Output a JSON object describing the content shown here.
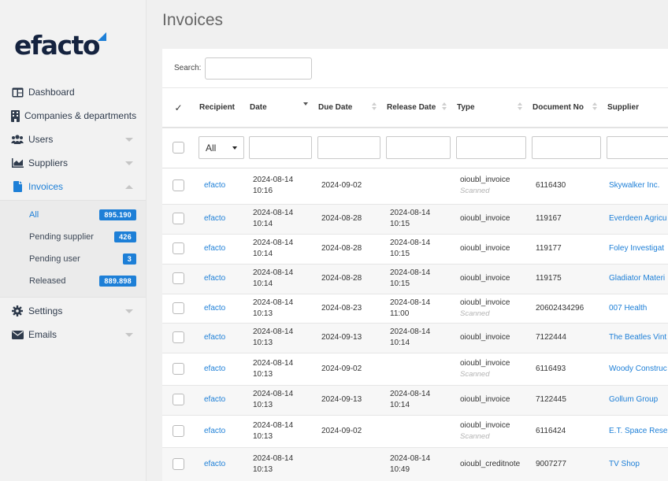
{
  "app": {
    "logo_text": "efacto",
    "page_title": "Invoices",
    "brand_color": "#1d7fd7"
  },
  "sidebar": {
    "items": [
      {
        "label": "Dashboard",
        "icon": "dashboard-icon"
      },
      {
        "label": "Companies & departments",
        "icon": "building-icon"
      },
      {
        "label": "Users",
        "icon": "users-icon"
      },
      {
        "label": "Suppliers",
        "icon": "chart-icon"
      },
      {
        "label": "Invoices",
        "icon": "document-icon"
      },
      {
        "label": "Settings",
        "icon": "gear-icon"
      },
      {
        "label": "Emails",
        "icon": "envelope-icon"
      }
    ],
    "invoices_sub": [
      {
        "label": "All",
        "count": "895.190"
      },
      {
        "label": "Pending supplier",
        "count": "426"
      },
      {
        "label": "Pending user",
        "count": "3"
      },
      {
        "label": "Released",
        "count": "889.898"
      }
    ]
  },
  "search": {
    "label": "Search:",
    "value": ""
  },
  "table": {
    "check_header": "✓",
    "headers": [
      "Recipient",
      "Date",
      "Due Date",
      "Release Date",
      "Type",
      "Document No",
      "Supplier"
    ],
    "filter_select": "All",
    "rows": [
      {
        "recipient": "efacto",
        "date": "2024-08-14",
        "date_time": "10:16",
        "due": "2024-09-02",
        "release": "",
        "release_time": "",
        "type": "oioubl_invoice",
        "type_sub": "Scanned",
        "doc": "6116430",
        "supplier": "Skywalker Inc."
      },
      {
        "recipient": "efacto",
        "date": "2024-08-14",
        "date_time": "10:14",
        "due": "2024-08-28",
        "release": "2024-08-14",
        "release_time": "10:15",
        "type": "oioubl_invoice",
        "type_sub": "",
        "doc": "119167",
        "supplier": "Everdeen Agricu"
      },
      {
        "recipient": "efacto",
        "date": "2024-08-14",
        "date_time": "10:14",
        "due": "2024-08-28",
        "release": "2024-08-14",
        "release_time": "10:15",
        "type": "oioubl_invoice",
        "type_sub": "",
        "doc": "119177",
        "supplier": "Foley Investigat"
      },
      {
        "recipient": "efacto",
        "date": "2024-08-14",
        "date_time": "10:14",
        "due": "2024-08-28",
        "release": "2024-08-14",
        "release_time": "10:15",
        "type": "oioubl_invoice",
        "type_sub": "",
        "doc": "119175",
        "supplier": "Gladiator Materi"
      },
      {
        "recipient": "efacto",
        "date": "2024-08-14",
        "date_time": "10:13",
        "due": "2024-08-23",
        "release": "2024-08-14",
        "release_time": "11:00",
        "type": "oioubl_invoice",
        "type_sub": "Scanned",
        "doc": "20602434296",
        "supplier": "007 Health"
      },
      {
        "recipient": "efacto",
        "date": "2024-08-14",
        "date_time": "10:13",
        "due": "2024-09-13",
        "release": "2024-08-14",
        "release_time": "10:14",
        "type": "oioubl_invoice",
        "type_sub": "",
        "doc": "7122444",
        "supplier": "The Beatles Vint"
      },
      {
        "recipient": "efacto",
        "date": "2024-08-14",
        "date_time": "10:13",
        "due": "2024-09-02",
        "release": "",
        "release_time": "",
        "type": "oioubl_invoice",
        "type_sub": "Scanned",
        "doc": "6116493",
        "supplier": "Woody Construc"
      },
      {
        "recipient": "efacto",
        "date": "2024-08-14",
        "date_time": "10:13",
        "due": "2024-09-13",
        "release": "2024-08-14",
        "release_time": "10:14",
        "type": "oioubl_invoice",
        "type_sub": "",
        "doc": "7122445",
        "supplier": "Gollum Group"
      },
      {
        "recipient": "efacto",
        "date": "2024-08-14",
        "date_time": "10:13",
        "due": "2024-09-02",
        "release": "",
        "release_time": "",
        "type": "oioubl_invoice",
        "type_sub": "Scanned",
        "doc": "6116424",
        "supplier": "E.T. Space Rese"
      },
      {
        "recipient": "efacto",
        "date": "2024-08-14",
        "date_time": "10:13",
        "due": "",
        "release": "2024-08-14",
        "release_time": "10:49",
        "type": "oioubl_creditnote",
        "type_sub": "",
        "doc": "9007277",
        "supplier": "TV Shop"
      }
    ]
  }
}
